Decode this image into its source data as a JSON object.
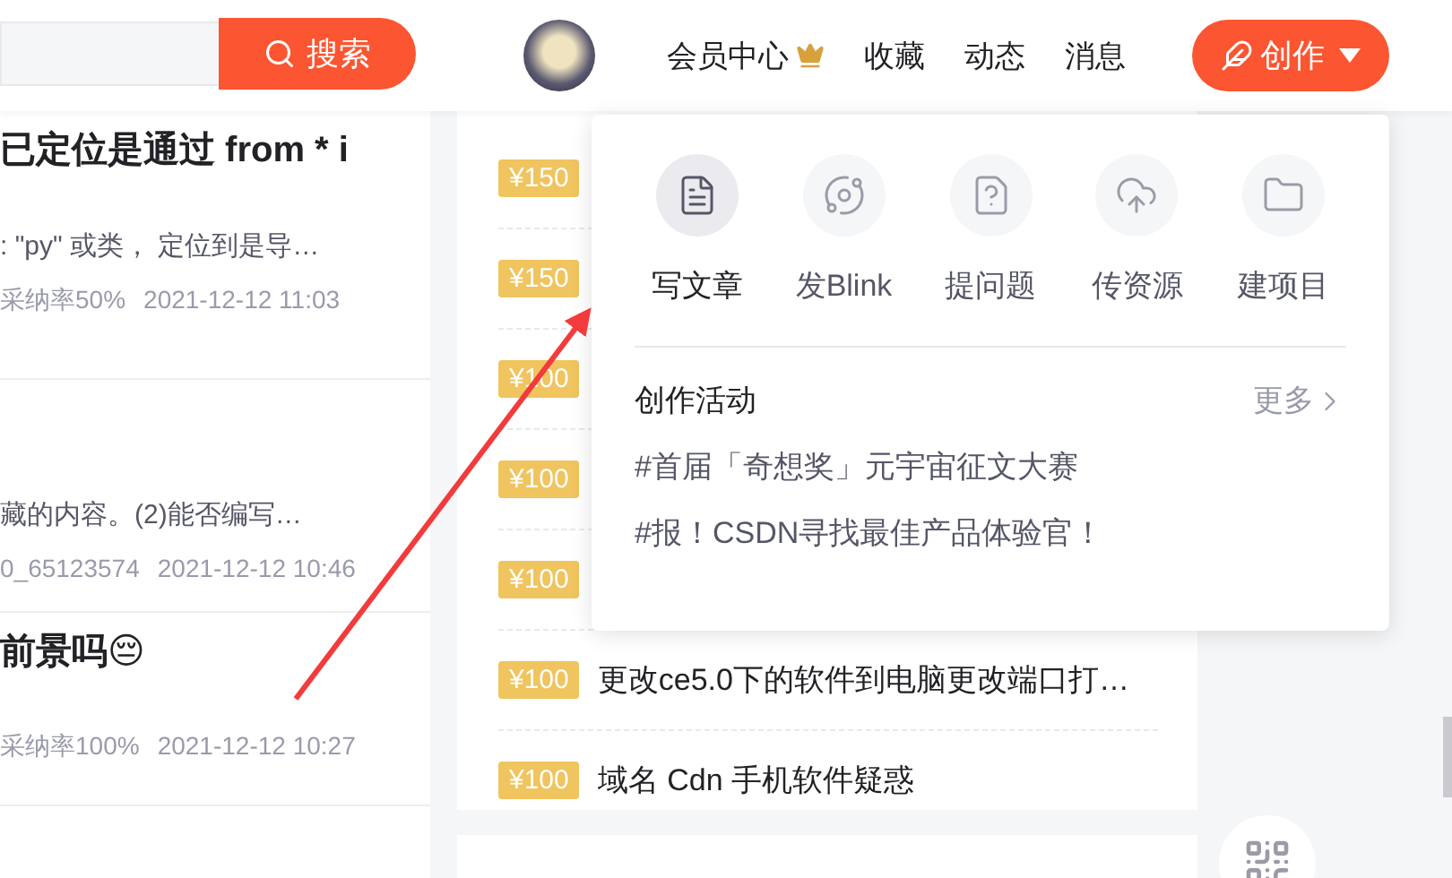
{
  "header": {
    "search_button": "搜索",
    "nav": [
      {
        "label": "会员中心",
        "kind": "vip"
      },
      {
        "label": "收藏",
        "kind": "plain"
      },
      {
        "label": "动态",
        "kind": "plain"
      },
      {
        "label": "消息",
        "kind": "plain"
      }
    ],
    "create_button": "创作"
  },
  "questions": [
    {
      "title": "已定位是通过 from * i",
      "description": ": \"py\" 或类， 定位到是导…",
      "meta": [
        "采纳率50%",
        "2021-12-12 11:03"
      ]
    },
    {
      "description": "藏的内容。(2)能否编写…",
      "meta": [
        "0_65123574",
        "2021-12-12 10:46"
      ]
    },
    {
      "title": "前景吗😔",
      "meta": [
        "采纳率100%",
        "2021-12-12 10:27"
      ]
    }
  ],
  "bounties": [
    {
      "price": "¥150"
    },
    {
      "price": "¥150"
    },
    {
      "price": "¥100"
    },
    {
      "price": "¥100"
    },
    {
      "price": "¥100"
    },
    {
      "price": "¥100",
      "title": "更改ce5.0下的软件到电脑更改端口打…"
    },
    {
      "price": "¥100",
      "title": "域名 Cdn 手机软件疑惑"
    }
  ],
  "create_menu": {
    "actions": [
      {
        "label": "写文章",
        "kind": "article",
        "selected": true
      },
      {
        "label": "发Blink",
        "kind": "blink",
        "selected": false
      },
      {
        "label": "提问题",
        "kind": "question",
        "selected": false
      },
      {
        "label": "传资源",
        "kind": "upload",
        "selected": false
      },
      {
        "label": "建项目",
        "kind": "project",
        "selected": false
      }
    ],
    "activities_title": "创作活动",
    "more": "更多",
    "activities": [
      "#首届「奇想奖」元宇宙征文大赛",
      "#报！CSDN寻找最佳产品体验官！"
    ]
  }
}
